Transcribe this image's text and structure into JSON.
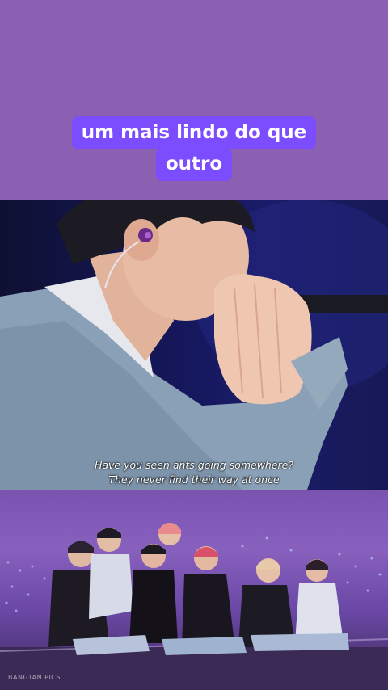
{
  "caption": {
    "line1": "um mais lindo do que",
    "line2": "outro"
  },
  "video1": {
    "subtitle_line1": "Have you seen ants going somewhere?",
    "subtitle_line2": "They never find their way at once"
  },
  "video2": {
    "watermark": "BANGTAN.PICS"
  },
  "colors": {
    "background": "#8b60b2",
    "caption_bg": "#7b4dff",
    "caption_text": "#ffffff"
  }
}
